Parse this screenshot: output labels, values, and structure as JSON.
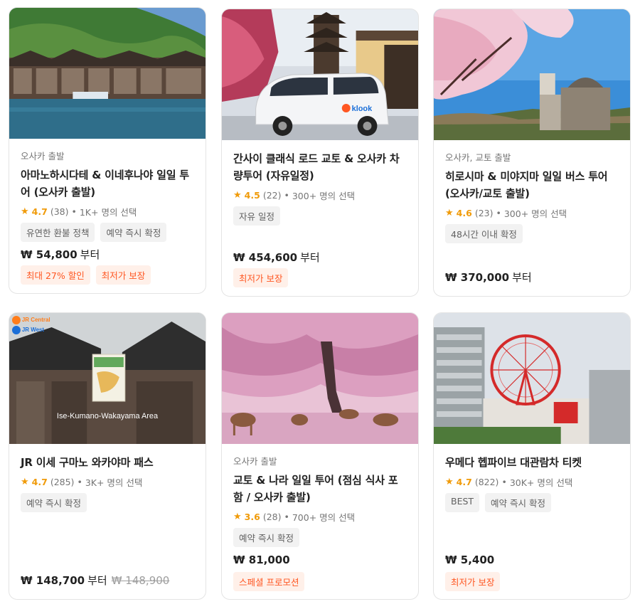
{
  "cards": [
    {
      "origin": "오사카 출발",
      "title": "아마노하시다테 & 이네후나야 일일 투어 (오사카 출발)",
      "rating": "4.7",
      "reviews": "(38)",
      "booked": "1K+ 명의 선택",
      "tags": [
        "유연한 환불 정책",
        "예약 즉시 확정"
      ],
      "price": "₩ 54,800",
      "price_suffix": "부터",
      "promos": [
        "최대 27% 할인",
        "최저가 보장"
      ]
    },
    {
      "origin": "",
      "title": "간사이 클래식 로드 교토 & 오사카 차량투어 (자유일정)",
      "rating": "4.5",
      "reviews": "(22)",
      "booked": "300+ 명의 선택",
      "tags": [
        "자유 일정"
      ],
      "price": "₩ 454,600",
      "price_suffix": "부터",
      "promos": [
        "최저가 보장"
      ],
      "van_logo": "klook"
    },
    {
      "origin": "오사카, 교토 출발",
      "title": "히로시마 & 미야지마 일일 버스 투어 (오사카/교토 출발)",
      "rating": "4.6",
      "reviews": "(23)",
      "booked": "300+ 명의 선택",
      "tags": [
        "48시간 이내 확정"
      ],
      "price": "₩ 370,000",
      "price_suffix": "부터",
      "promos": []
    },
    {
      "origin": "",
      "title": "JR 이세 구마노 와카야마 패스",
      "rating": "4.7",
      "reviews": "(285)",
      "booked": "3K+ 명의 선택",
      "tags": [
        "예약 즉시 확정"
      ],
      "price": "₩ 148,700",
      "price_suffix": "부터",
      "old_price": "₩ 148,900",
      "promos": [],
      "image_caption": "Ise-Kumano-Wakayama Area",
      "jr_logo_1": "JR Central",
      "jr_logo_2": "JR West"
    },
    {
      "origin": "오사카 출발",
      "title": "교토 & 나라 일일 투어 (점심 식사 포함 / 오사카 출발)",
      "rating": "3.6",
      "reviews": "(28)",
      "booked": "700+ 명의 선택",
      "tags": [
        "예약 즉시 확정"
      ],
      "price": "₩ 81,000",
      "price_suffix": "",
      "promos": [
        "스페셜 프로모션"
      ]
    },
    {
      "origin": "",
      "title": "우메다 헵파이브 대관람차 티켓",
      "rating": "4.7",
      "reviews": "(822)",
      "booked": "30K+ 명의 선택",
      "tags": [
        "BEST",
        "예약 즉시 확정"
      ],
      "price": "₩ 5,400",
      "price_suffix": "",
      "promos": [
        "최저가 보장"
      ]
    }
  ],
  "icons": {
    "star": "star-icon"
  },
  "colors": {
    "accent": "#f09b0a",
    "promo": "#ff5722",
    "promo_bg": "#fff0e9"
  }
}
